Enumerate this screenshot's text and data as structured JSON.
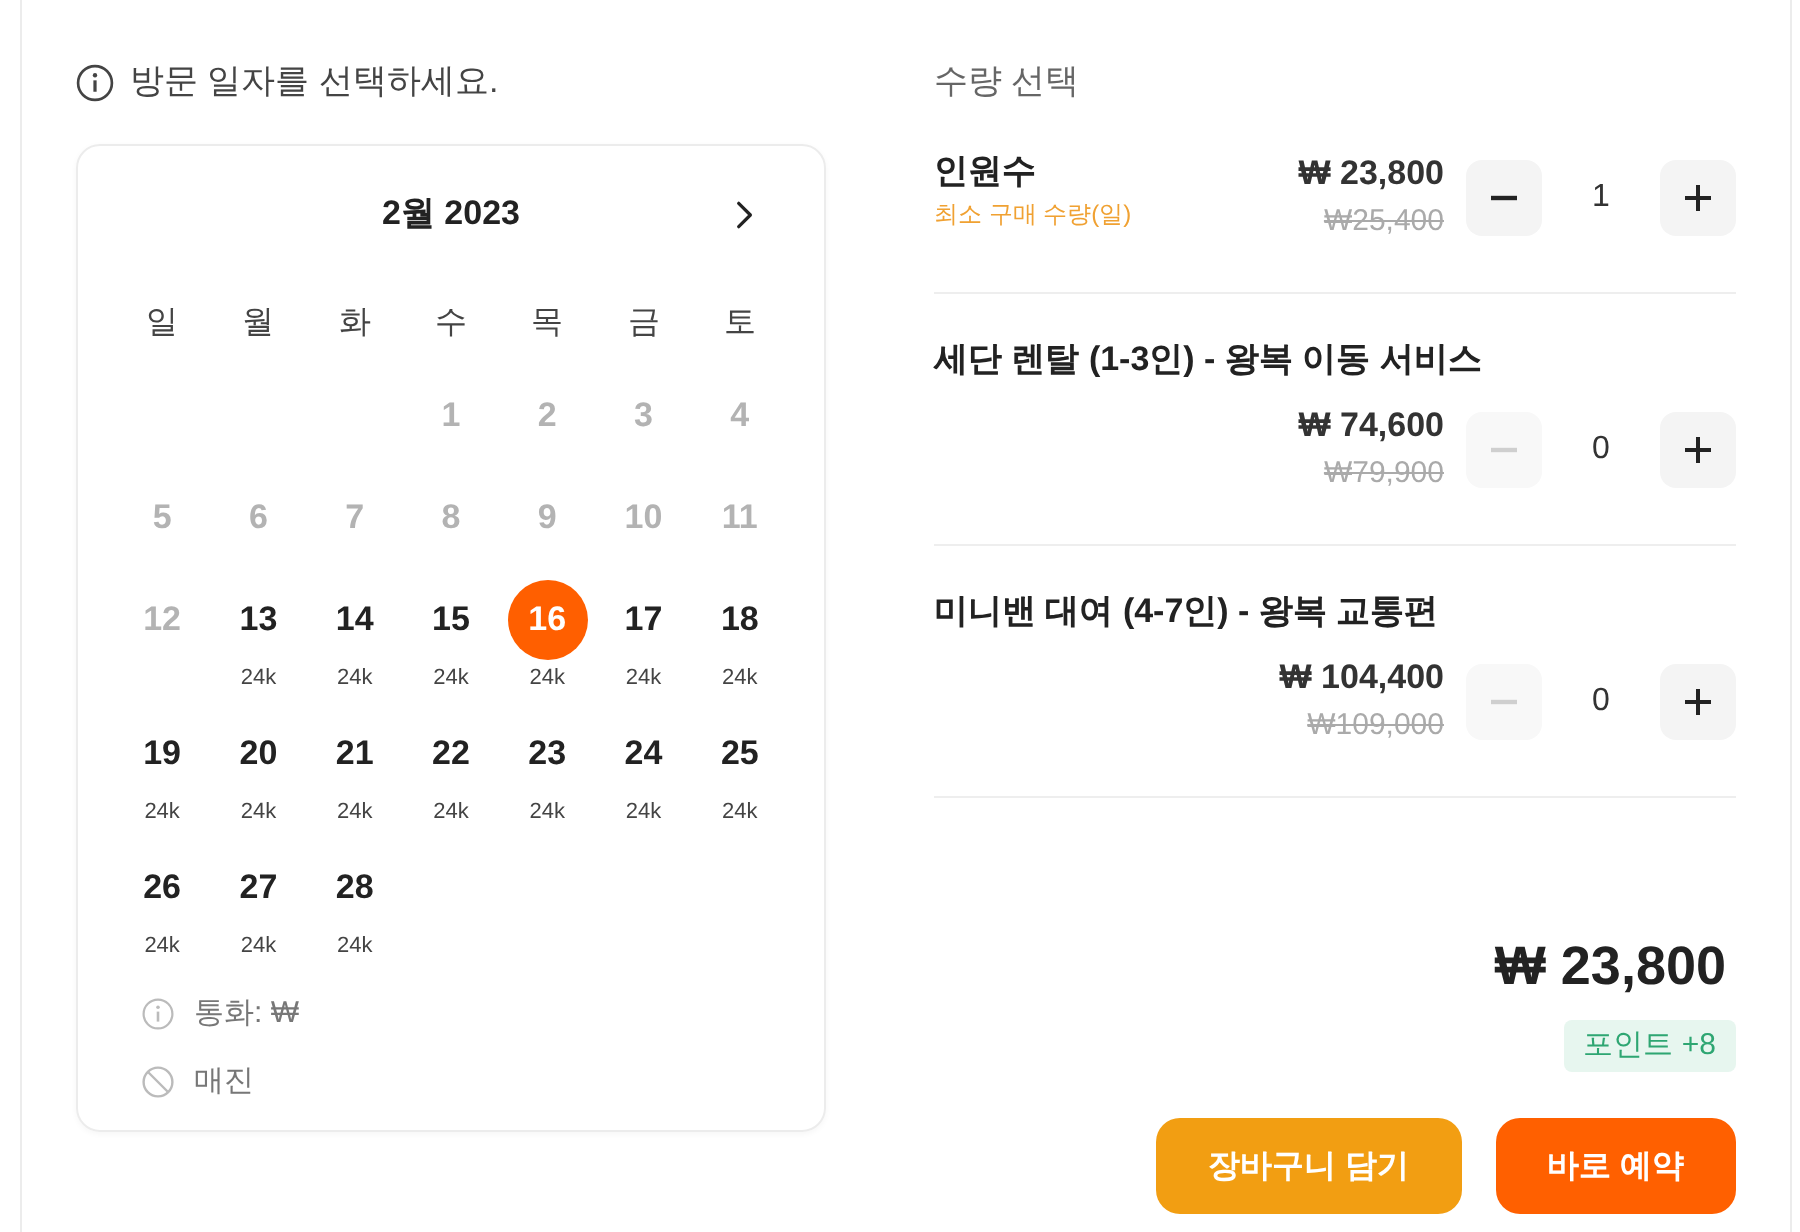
{
  "prompt": {
    "text": "방문 일자를 선택하세요."
  },
  "calendar": {
    "month": "2월 2023",
    "weekdays": [
      "일",
      "월",
      "화",
      "수",
      "목",
      "금",
      "토"
    ],
    "weeks": [
      [
        {
          "day": "1",
          "disabled": true,
          "selected": false
        },
        {
          "day": "2",
          "disabled": true,
          "selected": false
        },
        {
          "day": "3",
          "disabled": true,
          "selected": false
        },
        {
          "day": "4",
          "disabled": true,
          "selected": false
        }
      ],
      [
        {
          "day": "5",
          "disabled": true,
          "selected": false
        },
        {
          "day": "6",
          "disabled": true,
          "selected": false
        },
        {
          "day": "7",
          "disabled": true,
          "selected": false
        },
        {
          "day": "8",
          "disabled": true,
          "selected": false
        },
        {
          "day": "9",
          "disabled": true,
          "selected": false
        },
        {
          "day": "10",
          "disabled": true,
          "selected": false
        },
        {
          "day": "11",
          "disabled": true,
          "selected": false
        }
      ],
      [
        {
          "day": "12",
          "disabled": true,
          "selected": false
        },
        {
          "day": "13",
          "disabled": false,
          "selected": false,
          "price": "24k"
        },
        {
          "day": "14",
          "disabled": false,
          "selected": false,
          "price": "24k"
        },
        {
          "day": "15",
          "disabled": false,
          "selected": false,
          "price": "24k"
        },
        {
          "day": "16",
          "disabled": false,
          "selected": true,
          "price": "24k"
        },
        {
          "day": "17",
          "disabled": false,
          "selected": false,
          "price": "24k"
        },
        {
          "day": "18",
          "disabled": false,
          "selected": false,
          "price": "24k"
        }
      ],
      [
        {
          "day": "19",
          "disabled": false,
          "selected": false,
          "price": "24k"
        },
        {
          "day": "20",
          "disabled": false,
          "selected": false,
          "price": "24k"
        },
        {
          "day": "21",
          "disabled": false,
          "selected": false,
          "price": "24k"
        },
        {
          "day": "22",
          "disabled": false,
          "selected": false,
          "price": "24k"
        },
        {
          "day": "23",
          "disabled": false,
          "selected": false,
          "price": "24k"
        },
        {
          "day": "24",
          "disabled": false,
          "selected": false,
          "price": "24k"
        },
        {
          "day": "25",
          "disabled": false,
          "selected": false,
          "price": "24k"
        }
      ],
      [
        {
          "day": "26",
          "disabled": false,
          "selected": false,
          "price": "24k"
        },
        {
          "day": "27",
          "disabled": false,
          "selected": false,
          "price": "24k"
        },
        {
          "day": "28",
          "disabled": false,
          "selected": false,
          "price": "24k"
        }
      ]
    ],
    "legend": [
      {
        "kind": "currency",
        "text": "통화: ₩"
      },
      {
        "kind": "sold_out",
        "text": "매진"
      }
    ]
  },
  "quantity": {
    "title": "수량 선택",
    "items": [
      {
        "name": "인원수",
        "note": "최소 구매 수량(일)",
        "price": "₩ 23,800",
        "original_price": "₩25,400",
        "quantity": "1",
        "minus_disabled": false
      },
      {
        "name": "세단 렌탈 (1-3인) - 왕복 이동 서비스",
        "price": "₩ 74,600",
        "original_price": "₩79,900",
        "quantity": "0",
        "minus_disabled": true
      },
      {
        "name": "미니밴 대여 (4-7인) - 왕복 교통편",
        "price": "₩ 104,400",
        "original_price": "₩109,000",
        "quantity": "0",
        "minus_disabled": true
      }
    ]
  },
  "summary": {
    "total": "₩ 23,800",
    "points": "포인트 +8"
  },
  "actions": [
    {
      "kind": "secondary",
      "label": "장바구니 담기"
    },
    {
      "kind": "primary",
      "label": "바로 예약"
    }
  ]
}
